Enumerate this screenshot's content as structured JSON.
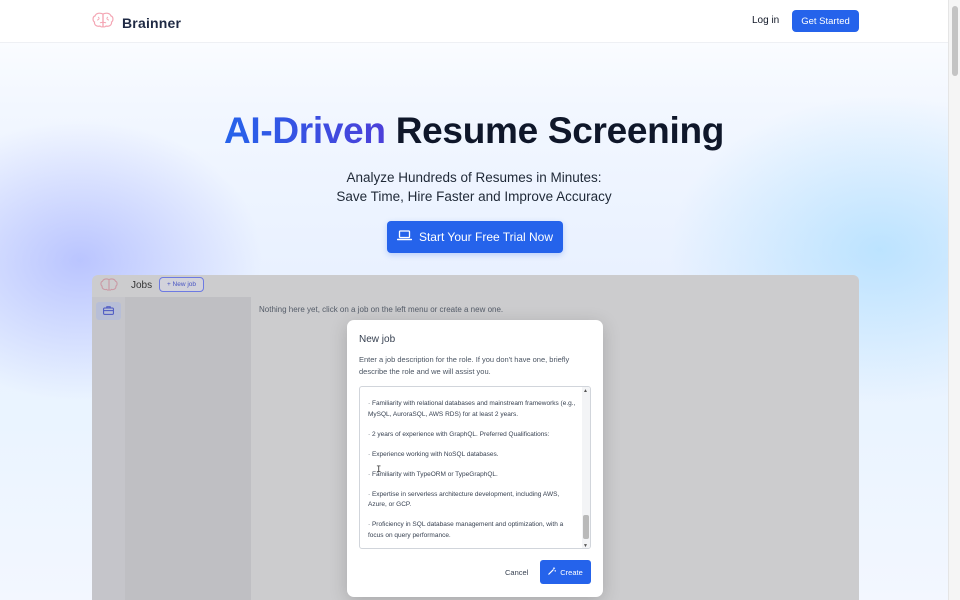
{
  "header": {
    "brand": "Brainner",
    "login_label": "Log in",
    "get_started_label": "Get Started"
  },
  "hero": {
    "title_accent": "AI-Driven",
    "title_rest": "Resume Screening",
    "subtitle_line1": "Analyze Hundreds of Resumes in Minutes:",
    "subtitle_line2": "Save Time, Hire Faster and Improve Accuracy",
    "cta_label": "Start Your Free Trial Now"
  },
  "app": {
    "section_title": "Jobs",
    "new_job_label": "+ New job",
    "empty_message": "Nothing here yet, click on a job on the left menu or create a new one."
  },
  "modal": {
    "title": "New job",
    "description": "Enter a job description for the role. If you don't have one, briefly describe the role and we will assist you.",
    "textarea_lines": [
      "· Familiarity with relational databases and mainstream frameworks (e.g., MySQL, AuroraSQL, AWS RDS) for at least 2 years.",
      "· 2 years of experience with GraphQL. Preferred Qualifications:",
      "· Experience working with NoSQL databases.",
      "· Familiarity with TypeORM or TypeGraphQL.",
      "· Expertise in serverless architecture development, including AWS, Azure, or GCP.",
      "· Proficiency in SQL database management and optimization, with a focus on query performance."
    ],
    "cancel_label": "Cancel",
    "create_label": "Create"
  },
  "colors": {
    "primary": "#2563eb",
    "text_dark": "#0f172a"
  }
}
